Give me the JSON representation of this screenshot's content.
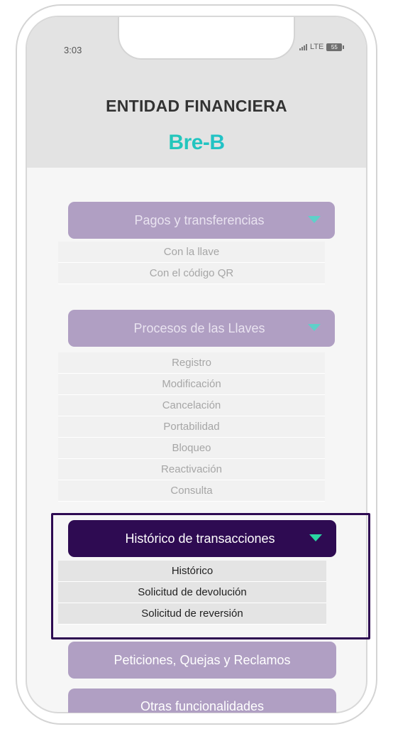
{
  "status_bar": {
    "time": "3:03",
    "network": "LTE",
    "battery": "55"
  },
  "header": {
    "title": "ENTIDAD FINANCIERA",
    "brand": "Bre-B"
  },
  "menu": {
    "payments": {
      "label": "Pagos y transferencias",
      "items": [
        "Con la llave",
        "Con el código QR"
      ]
    },
    "keys": {
      "label": "Procesos de las Llaves",
      "items": [
        "Registro",
        "Modificación",
        "Cancelación",
        "Portabilidad",
        "Bloqueo",
        "Reactivación",
        "Consulta"
      ]
    },
    "history": {
      "label": "Histórico de transacciones",
      "items": [
        "Histórico",
        "Solicitud de devolución",
        "Solicitud de reversión"
      ]
    },
    "pqr": {
      "label": "Peticiones, Quejas y Reclamos"
    },
    "other": {
      "label": "Otras funcionalidades"
    }
  },
  "colors": {
    "active_button": "#2e0b52",
    "inactive_button": "#b09fc3",
    "caret": "#29d5a2",
    "brand_gradient_start": "#29d39a",
    "brand_gradient_end": "#1cb6e6"
  }
}
